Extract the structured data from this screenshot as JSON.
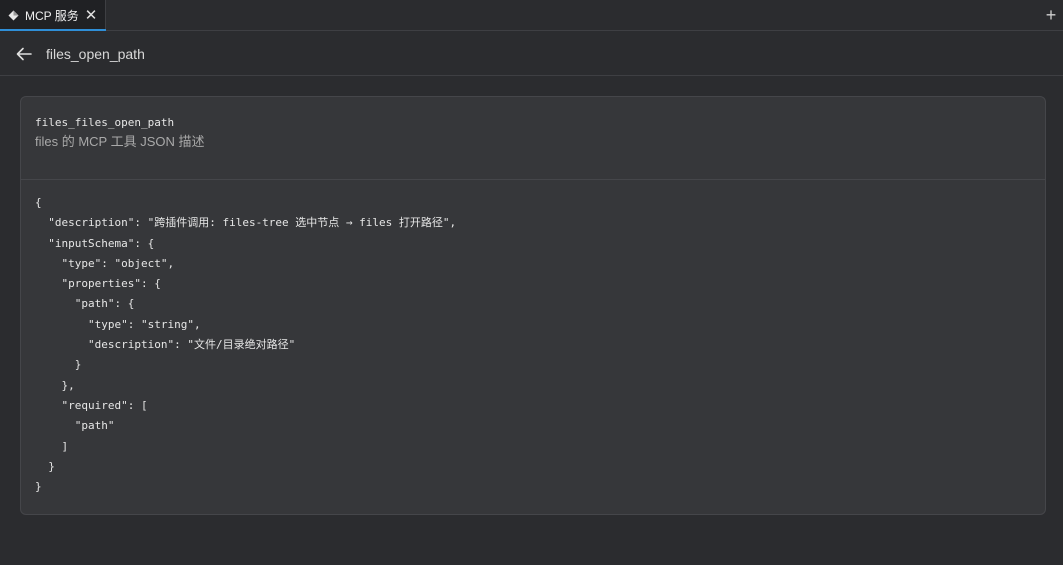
{
  "tab": {
    "label": "MCP 服务",
    "close_label": "✕",
    "new_tab_label": "+"
  },
  "header": {
    "title": "files_open_path"
  },
  "card": {
    "tool_name": "files_files_open_path",
    "tool_description": "files 的 MCP 工具 JSON 描述",
    "json_lines": [
      "{",
      "  \"description\": \"跨插件调用: files-tree 选中节点 → files 打开路径\",",
      "  \"inputSchema\": {",
      "    \"type\": \"object\",",
      "    \"properties\": {",
      "      \"path\": {",
      "        \"type\": \"string\",",
      "        \"description\": \"文件/目录绝对路径\"",
      "      }",
      "    },",
      "    \"required\": [",
      "      \"path\"",
      "    ]",
      "  }",
      "}"
    ]
  },
  "colors": {
    "background": "#2b2c2f",
    "card": "#36373a",
    "accent": "#2f8fd8"
  }
}
